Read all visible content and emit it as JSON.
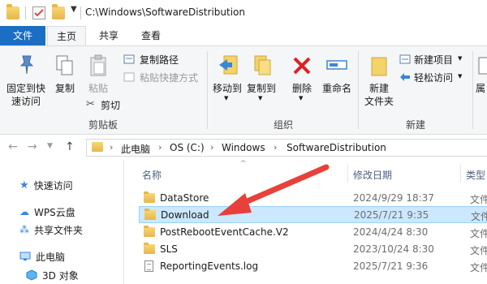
{
  "window": {
    "title": "C:\\Windows\\SoftwareDistribution"
  },
  "tabs": {
    "file": "文件",
    "home": "主页",
    "share": "共享",
    "view": "查看"
  },
  "ribbon": {
    "pin": "固定到快\n速访问",
    "copy": "复制",
    "paste": "粘贴",
    "copy_path": "复制路径",
    "paste_shortcut": "粘贴快捷方式",
    "cut": "剪切",
    "clipboard_group": "剪贴板",
    "move_to": "移动到",
    "copy_to": "复制到",
    "delete": "删除",
    "rename": "重命名",
    "organize_group": "组织",
    "new_folder": "新建\n文件夹",
    "new_item": "新建项目",
    "easy_access": "轻松访问",
    "new_group": "新建",
    "partial_label": "属"
  },
  "address": {
    "crumbs": [
      "此电脑",
      "OS (C:)",
      "Windows",
      "SoftwareDistribution"
    ]
  },
  "navpane": {
    "items": [
      {
        "label": "快速访问",
        "icon": "star-icon"
      },
      {
        "label": "WPS云盘",
        "icon": "cloud-icon"
      },
      {
        "label": "共享文件夹",
        "icon": "share-folder-icon"
      },
      {
        "label": "此电脑",
        "icon": "computer-icon"
      },
      {
        "label": "3D 对象",
        "icon": "3d-objects-icon"
      }
    ]
  },
  "filelist": {
    "columns": {
      "name": "名称",
      "date": "修改日期",
      "type": "类型"
    },
    "rows": [
      {
        "name": "DataStore",
        "date": "2024/9/29 18:37",
        "type": "文件",
        "kind": "folder"
      },
      {
        "name": "Download",
        "date": "2025/7/21 9:35",
        "type": "文件",
        "kind": "folder",
        "selected": true
      },
      {
        "name": "PostRebootEventCache.V2",
        "date": "2024/4/24 8:30",
        "type": "文件",
        "kind": "folder"
      },
      {
        "name": "SLS",
        "date": "2023/10/24 8:30",
        "type": "文件",
        "kind": "folder"
      },
      {
        "name": "ReportingEvents.log",
        "date": "2025/7/21 9:36",
        "type": "文件",
        "kind": "file"
      }
    ]
  },
  "annotation": {
    "arrow_color": "#e8403a",
    "target": "Download"
  }
}
